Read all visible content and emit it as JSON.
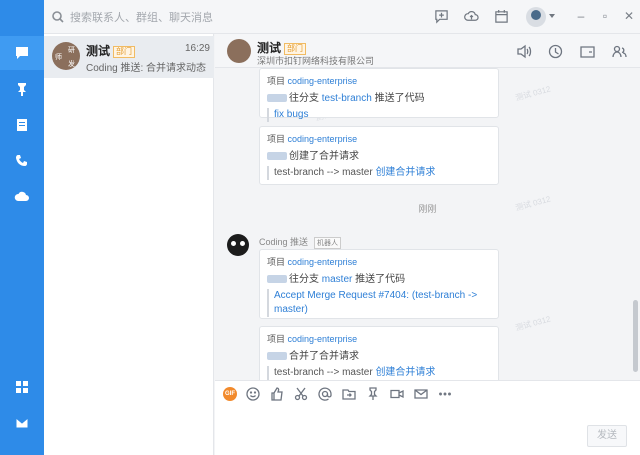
{
  "search": {
    "placeholder": "搜索联系人、群组、聊天消息"
  },
  "rail": {
    "items": [
      "chat-icon",
      "pin-icon",
      "notes-icon",
      "phone-icon",
      "cloud-icon"
    ],
    "bottom": [
      "apps-icon",
      "mail-icon"
    ]
  },
  "conversation": {
    "name": "测试",
    "tag": "部门",
    "time": "16:29",
    "preview": "Coding 推送: 合并请求动态",
    "avatar_chars": [
      "师",
      "研",
      "发"
    ]
  },
  "chat_header": {
    "name": "测试",
    "tag": "部门",
    "subtitle": "深圳市扣钉网络科技有限公司"
  },
  "messages": [
    {
      "project_label": "项目",
      "project": "coding-enterprise",
      "action_prefix": "往分支",
      "branch": "test-branch",
      "action_suffix": "推送了代码",
      "quote": "fix bugs"
    },
    {
      "project_label": "项目",
      "project": "coding-enterprise",
      "action": "创建了合并请求",
      "quote_text": "test-branch --> master",
      "quote_link": "创建合并请求"
    },
    {
      "time_separator": "刚刚"
    },
    {
      "sender": "Coding 推送",
      "sender_tag": "机器人",
      "project_label": "项目",
      "project": "coding-enterprise",
      "action_prefix": "往分支",
      "branch": "master",
      "action_suffix": "推送了代码",
      "quote": "Accept Merge Request #7404: (test-branch -> master)"
    },
    {
      "project_label": "项目",
      "project": "coding-enterprise",
      "action": "合并了合并请求",
      "quote_text": "test-branch --> master",
      "quote_link": "创建合并请求"
    }
  ],
  "watermark": "测试 0312",
  "input": {
    "send_label": "发送"
  },
  "colors": {
    "rail": "#2e8be8",
    "link": "#2e7fd6",
    "tag": "#e39a2b"
  }
}
